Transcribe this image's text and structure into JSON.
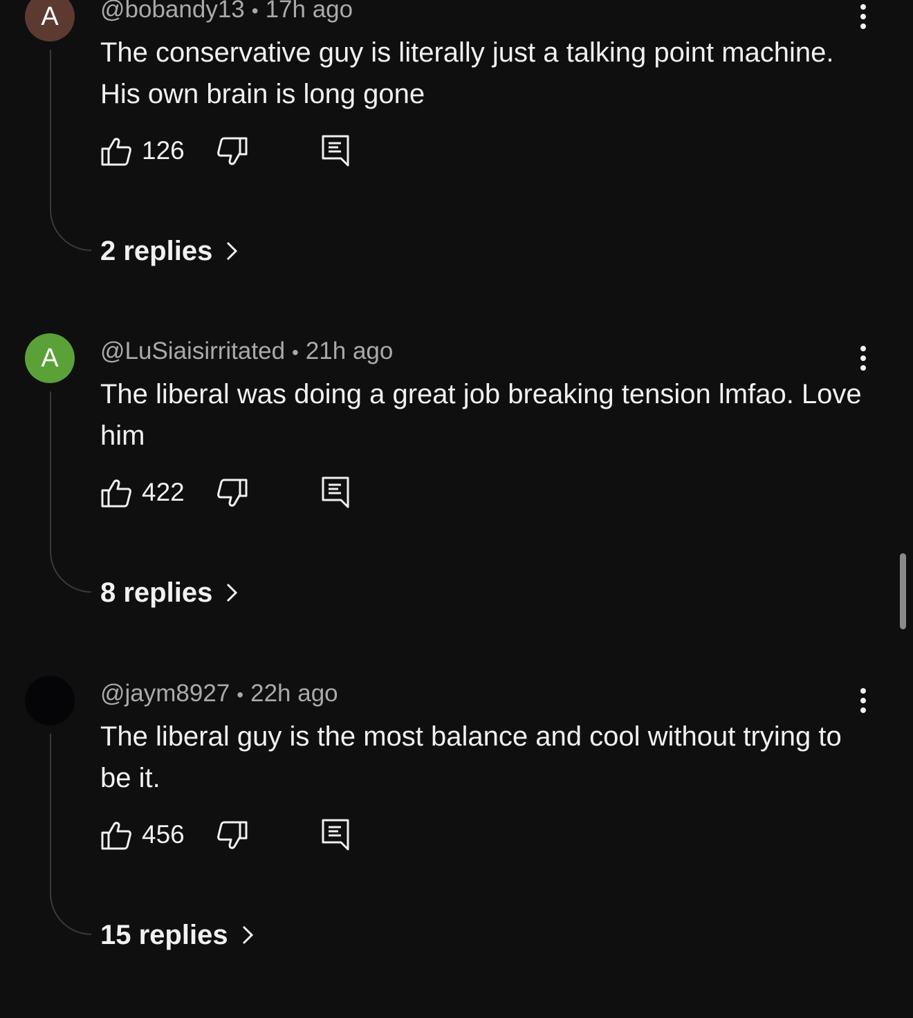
{
  "colors": {
    "background": "#0f0f0f",
    "text_primary": "#f1f1f1",
    "text_secondary": "#aaaaaa",
    "thread_line": "#3a3a3a"
  },
  "comments": [
    {
      "avatar_letter": "A",
      "avatar_color": "#5d3a31",
      "username": "@bobandy13",
      "separator": "•",
      "time": "17h ago",
      "text": "The conservative guy is literally just a talking point machine. His own brain is long gone",
      "likes": "126",
      "replies_label": "2 replies",
      "icons": [
        "thumbs-up-icon",
        "thumbs-down-icon",
        "reply-icon",
        "more-vertical-icon",
        "chevron-right-icon"
      ]
    },
    {
      "avatar_letter": "A",
      "avatar_color": "#5aa138",
      "username": "@LuSiaisirritated",
      "separator": "•",
      "time": "21h ago",
      "text": "The liberal was doing a great job breaking tension lmfao. Love him",
      "likes": "422",
      "replies_label": "8 replies",
      "icons": [
        "thumbs-up-icon",
        "thumbs-down-icon",
        "reply-icon",
        "more-vertical-icon",
        "chevron-right-icon"
      ]
    },
    {
      "avatar_letter": "",
      "avatar_color": "#050508",
      "username": "@jaym8927",
      "separator": "•",
      "time": "22h ago",
      "text": "The liberal guy is the most balance and cool without trying to be it.",
      "likes": "456",
      "replies_label": "15 replies",
      "icons": [
        "thumbs-up-icon",
        "thumbs-down-icon",
        "reply-icon",
        "more-vertical-icon",
        "chevron-right-icon"
      ]
    }
  ]
}
